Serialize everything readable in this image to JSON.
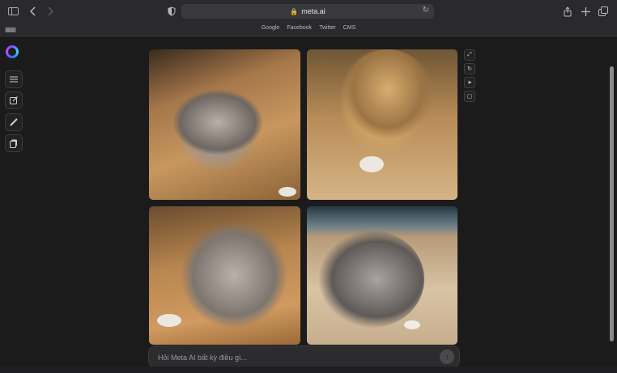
{
  "browser": {
    "url": "meta.ai",
    "bookmarks": [
      "Google",
      "Facebook",
      "Twitter",
      "CMS"
    ]
  },
  "composer": {
    "placeholder": "Hỏi Meta AI bất kỳ điều gì..."
  },
  "icons": {
    "sidebar": [
      "meta-ai-logo-icon",
      "menu-icon",
      "new-chat-icon",
      "pen-icon",
      "pages-icon"
    ],
    "image_actions": [
      "expand-icon",
      "regenerate-icon",
      "share-icon",
      "copy-icon"
    ]
  },
  "colors": {
    "background": "#1b1b1c",
    "toolbar": "#2a2a2c"
  }
}
